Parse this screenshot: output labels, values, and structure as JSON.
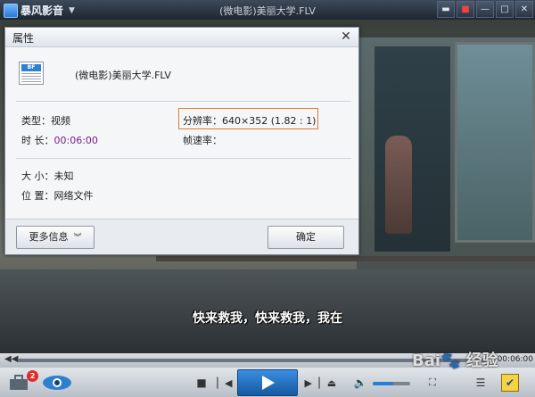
{
  "app": {
    "logo_text": "暴风影音",
    "window_title": "(微电影)美丽大学.FLV"
  },
  "video": {
    "subtitle": "快来救我，快来救我，我在"
  },
  "dialog": {
    "title": "属性",
    "file_icon_label": "BF",
    "file_name": "(微电影)美丽大学.FLV",
    "type_label": "类型：",
    "type_value": "视频",
    "duration_label": "时 长：",
    "duration_value": "00:06:00",
    "resolution_label": "分辨率：",
    "resolution_value": "640×352 (1.82 : 1)",
    "framerate_label": "帧速率：",
    "size_label": "大 小：",
    "size_value": "未知",
    "location_label": "位 置：",
    "location_value": "网络文件",
    "more_info_button": "更多信息",
    "ok_button": "确定"
  },
  "progress": {
    "time": "00:06:00",
    "played_fraction": 0.0
  },
  "controls": {
    "notification_count": "2",
    "volume_fraction": 0.55
  },
  "watermark": "Bai 经验"
}
